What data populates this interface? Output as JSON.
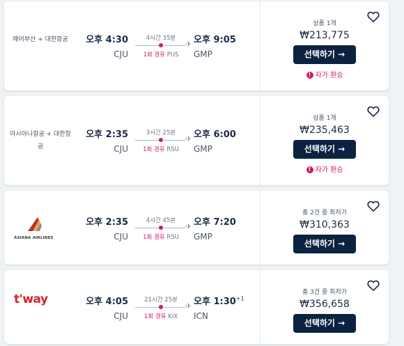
{
  "results": [
    {
      "airline": "에어부산 + 대한항공",
      "dep_time": "오후 4:30",
      "dep_code": "CJU",
      "duration": "4시간 35분",
      "stops": "1회 경유",
      "stop_airport": "PUS",
      "arr_time": "오후 9:05",
      "arr_code": "GMP",
      "arr_day": "",
      "price_label": "상품 1개",
      "price": "₩213,775",
      "select": "선택하기 →",
      "refund": "자가 환승"
    },
    {
      "airline": "아시아나항공 + 대한항공",
      "dep_time": "오후 2:35",
      "dep_code": "CJU",
      "duration": "3시간 25분",
      "stops": "1회 경유",
      "stop_airport": "RSU",
      "arr_time": "오후 6:00",
      "arr_code": "GMP",
      "arr_day": "",
      "price_label": "상품 1개",
      "price": "₩235,463",
      "select": "선택하기 →",
      "refund": "자가 환승"
    },
    {
      "airline": "ASIANA AIRLINES",
      "dep_time": "오후 2:35",
      "dep_code": "CJU",
      "duration": "4시간 45분",
      "stops": "1회 경유",
      "stop_airport": "RSU",
      "arr_time": "오후 7:20",
      "arr_code": "GMP",
      "arr_day": "",
      "price_label": "총 2건 중 최저가",
      "price": "₩310,363",
      "select": "선택하기 →"
    },
    {
      "airline": "t'way",
      "dep_time": "오후 4:05",
      "dep_code": "CJU",
      "duration": "21시간 25분",
      "stops": "1회 경유",
      "stop_airport": "KIX",
      "arr_time": "오후 1:30",
      "arr_code": "ICN",
      "arr_day": "+1",
      "price_label": "총 3건 중 최저가",
      "price": "₩356,658",
      "select": "선택하기 →"
    }
  ],
  "colors": {
    "accent": "#d11a6a",
    "button": "#0b2341",
    "text": "#1a2b49"
  }
}
